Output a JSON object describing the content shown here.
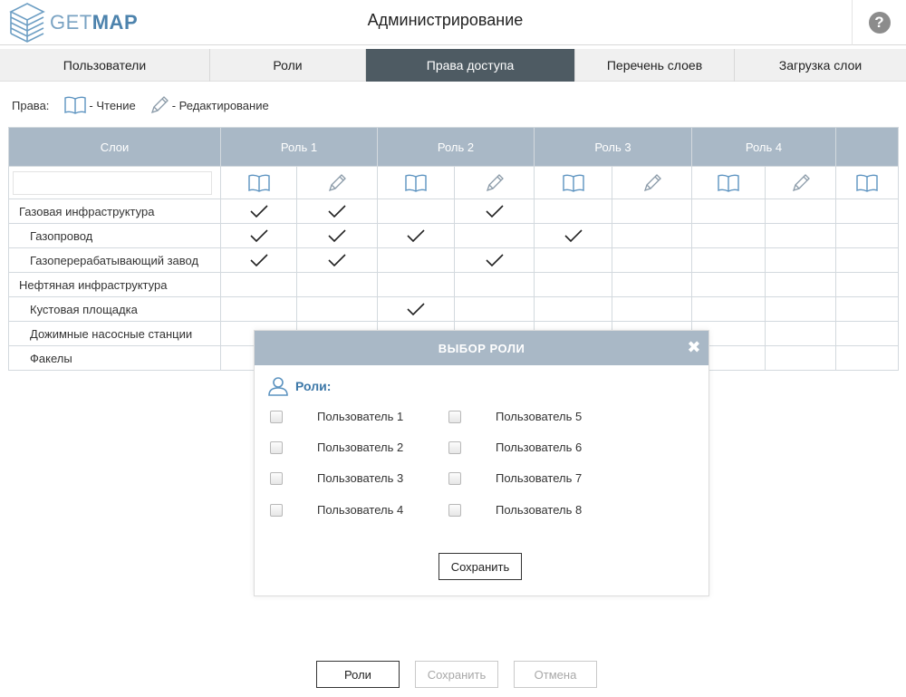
{
  "header": {
    "logo": {
      "get": "GET",
      "map": "MAP"
    },
    "title": "Администрирование",
    "help_label": "?"
  },
  "tabs": [
    {
      "label": "Пользователи",
      "active": false
    },
    {
      "label": "Роли",
      "active": false
    },
    {
      "label": "Права доступа",
      "active": true
    },
    {
      "label": "Перечень слоев",
      "active": false
    },
    {
      "label": "Загрузка слои",
      "active": false
    }
  ],
  "legend": {
    "label": "Права:",
    "read_text": "- Чтение",
    "edit_text": "- Редактирование"
  },
  "table": {
    "layers_header": "Слои",
    "roles": [
      "Роль 1",
      "Роль 2",
      "Роль 3",
      "Роль 4"
    ],
    "rows": [
      {
        "name": "Газовая инфраструктура",
        "indent": 0,
        "checks": [
          true,
          true,
          false,
          true,
          false,
          false,
          false,
          false,
          false
        ]
      },
      {
        "name": "Газопровод",
        "indent": 1,
        "checks": [
          true,
          true,
          true,
          false,
          true,
          false,
          false,
          false,
          false
        ]
      },
      {
        "name": "Газоперерабатывающий завод",
        "indent": 1,
        "checks": [
          true,
          true,
          false,
          true,
          false,
          false,
          false,
          false,
          false
        ]
      },
      {
        "name": "Нефтяная инфраструктура",
        "indent": 0,
        "checks": [
          false,
          false,
          false,
          false,
          false,
          false,
          false,
          false,
          false
        ]
      },
      {
        "name": "Кустовая площадка",
        "indent": 1,
        "checks": [
          false,
          false,
          true,
          false,
          false,
          false,
          false,
          false,
          false
        ]
      },
      {
        "name": "Дожимные насосные станции",
        "indent": 1,
        "checks": [
          false,
          false,
          false,
          false,
          false,
          false,
          false,
          false,
          false
        ]
      },
      {
        "name": "Факелы",
        "indent": 1,
        "checks": [
          false,
          false,
          false,
          false,
          false,
          false,
          false,
          false,
          false
        ]
      }
    ]
  },
  "modal": {
    "title": "ВЫБОР РОЛИ",
    "close": "✖",
    "roles_heading": "Роли:",
    "options": [
      "Пользователь 1",
      "Пользователь 2",
      "Пользователь 3",
      "Пользователь 4",
      "Пользователь 5",
      "Пользователь 6",
      "Пользователь 7",
      "Пользователь 8"
    ],
    "save_label": "Сохранить"
  },
  "footer": {
    "roles_label": "Роли",
    "save_label": "Сохранить",
    "cancel_label": "Отмена"
  },
  "colors": {
    "active_tab": "#4e5b63",
    "table_header": "#a9b8c6",
    "accent_blue": "#3d78a8",
    "icon_blue": "#5c93c0"
  }
}
